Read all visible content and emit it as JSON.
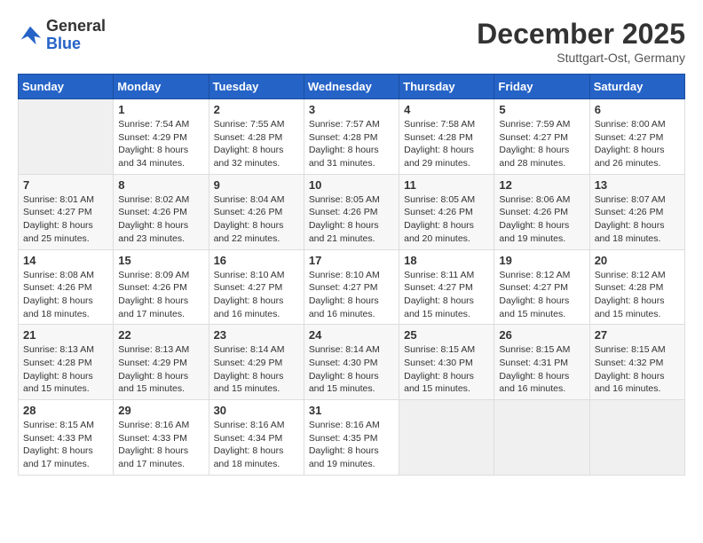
{
  "logo": {
    "general": "General",
    "blue": "Blue"
  },
  "title": "December 2025",
  "location": "Stuttgart-Ost, Germany",
  "days_header": [
    "Sunday",
    "Monday",
    "Tuesday",
    "Wednesday",
    "Thursday",
    "Friday",
    "Saturday"
  ],
  "weeks": [
    [
      {
        "num": "",
        "info": ""
      },
      {
        "num": "1",
        "info": "Sunrise: 7:54 AM\nSunset: 4:29 PM\nDaylight: 8 hours\nand 34 minutes."
      },
      {
        "num": "2",
        "info": "Sunrise: 7:55 AM\nSunset: 4:28 PM\nDaylight: 8 hours\nand 32 minutes."
      },
      {
        "num": "3",
        "info": "Sunrise: 7:57 AM\nSunset: 4:28 PM\nDaylight: 8 hours\nand 31 minutes."
      },
      {
        "num": "4",
        "info": "Sunrise: 7:58 AM\nSunset: 4:28 PM\nDaylight: 8 hours\nand 29 minutes."
      },
      {
        "num": "5",
        "info": "Sunrise: 7:59 AM\nSunset: 4:27 PM\nDaylight: 8 hours\nand 28 minutes."
      },
      {
        "num": "6",
        "info": "Sunrise: 8:00 AM\nSunset: 4:27 PM\nDaylight: 8 hours\nand 26 minutes."
      }
    ],
    [
      {
        "num": "7",
        "info": "Sunrise: 8:01 AM\nSunset: 4:27 PM\nDaylight: 8 hours\nand 25 minutes."
      },
      {
        "num": "8",
        "info": "Sunrise: 8:02 AM\nSunset: 4:26 PM\nDaylight: 8 hours\nand 23 minutes."
      },
      {
        "num": "9",
        "info": "Sunrise: 8:04 AM\nSunset: 4:26 PM\nDaylight: 8 hours\nand 22 minutes."
      },
      {
        "num": "10",
        "info": "Sunrise: 8:05 AM\nSunset: 4:26 PM\nDaylight: 8 hours\nand 21 minutes."
      },
      {
        "num": "11",
        "info": "Sunrise: 8:05 AM\nSunset: 4:26 PM\nDaylight: 8 hours\nand 20 minutes."
      },
      {
        "num": "12",
        "info": "Sunrise: 8:06 AM\nSunset: 4:26 PM\nDaylight: 8 hours\nand 19 minutes."
      },
      {
        "num": "13",
        "info": "Sunrise: 8:07 AM\nSunset: 4:26 PM\nDaylight: 8 hours\nand 18 minutes."
      }
    ],
    [
      {
        "num": "14",
        "info": "Sunrise: 8:08 AM\nSunset: 4:26 PM\nDaylight: 8 hours\nand 18 minutes."
      },
      {
        "num": "15",
        "info": "Sunrise: 8:09 AM\nSunset: 4:26 PM\nDaylight: 8 hours\nand 17 minutes."
      },
      {
        "num": "16",
        "info": "Sunrise: 8:10 AM\nSunset: 4:27 PM\nDaylight: 8 hours\nand 16 minutes."
      },
      {
        "num": "17",
        "info": "Sunrise: 8:10 AM\nSunset: 4:27 PM\nDaylight: 8 hours\nand 16 minutes."
      },
      {
        "num": "18",
        "info": "Sunrise: 8:11 AM\nSunset: 4:27 PM\nDaylight: 8 hours\nand 15 minutes."
      },
      {
        "num": "19",
        "info": "Sunrise: 8:12 AM\nSunset: 4:27 PM\nDaylight: 8 hours\nand 15 minutes."
      },
      {
        "num": "20",
        "info": "Sunrise: 8:12 AM\nSunset: 4:28 PM\nDaylight: 8 hours\nand 15 minutes."
      }
    ],
    [
      {
        "num": "21",
        "info": "Sunrise: 8:13 AM\nSunset: 4:28 PM\nDaylight: 8 hours\nand 15 minutes."
      },
      {
        "num": "22",
        "info": "Sunrise: 8:13 AM\nSunset: 4:29 PM\nDaylight: 8 hours\nand 15 minutes."
      },
      {
        "num": "23",
        "info": "Sunrise: 8:14 AM\nSunset: 4:29 PM\nDaylight: 8 hours\nand 15 minutes."
      },
      {
        "num": "24",
        "info": "Sunrise: 8:14 AM\nSunset: 4:30 PM\nDaylight: 8 hours\nand 15 minutes."
      },
      {
        "num": "25",
        "info": "Sunrise: 8:15 AM\nSunset: 4:30 PM\nDaylight: 8 hours\nand 15 minutes."
      },
      {
        "num": "26",
        "info": "Sunrise: 8:15 AM\nSunset: 4:31 PM\nDaylight: 8 hours\nand 16 minutes."
      },
      {
        "num": "27",
        "info": "Sunrise: 8:15 AM\nSunset: 4:32 PM\nDaylight: 8 hours\nand 16 minutes."
      }
    ],
    [
      {
        "num": "28",
        "info": "Sunrise: 8:15 AM\nSunset: 4:33 PM\nDaylight: 8 hours\nand 17 minutes."
      },
      {
        "num": "29",
        "info": "Sunrise: 8:16 AM\nSunset: 4:33 PM\nDaylight: 8 hours\nand 17 minutes."
      },
      {
        "num": "30",
        "info": "Sunrise: 8:16 AM\nSunset: 4:34 PM\nDaylight: 8 hours\nand 18 minutes."
      },
      {
        "num": "31",
        "info": "Sunrise: 8:16 AM\nSunset: 4:35 PM\nDaylight: 8 hours\nand 19 minutes."
      },
      {
        "num": "",
        "info": ""
      },
      {
        "num": "",
        "info": ""
      },
      {
        "num": "",
        "info": ""
      }
    ]
  ]
}
